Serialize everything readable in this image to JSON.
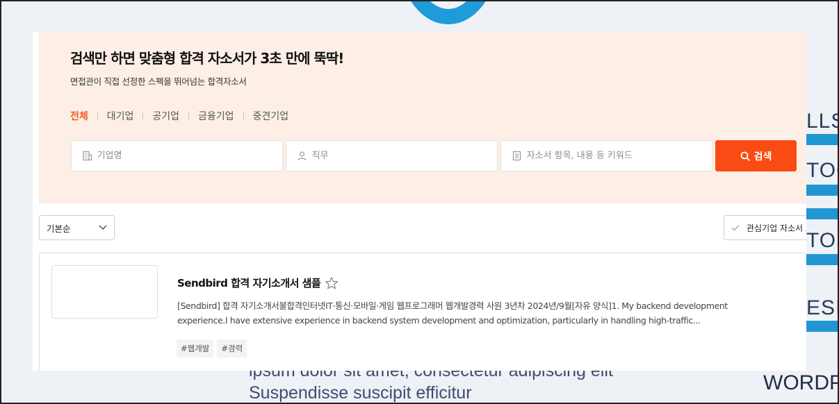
{
  "hero": {
    "title": "검색만 하면 맞춤형 합격 자소서가 3초 만에 뚝딱!",
    "subtitle": "면접관이 직접 선정한 스펙을 뛰어넘는 합격자소서"
  },
  "tabs": [
    {
      "label": "전체",
      "active": true
    },
    {
      "label": "대기업",
      "active": false
    },
    {
      "label": "공기업",
      "active": false
    },
    {
      "label": "금융기업",
      "active": false
    },
    {
      "label": "중견기업",
      "active": false
    }
  ],
  "search": {
    "company_placeholder": "기업명",
    "company_value": "",
    "job_placeholder": "직무",
    "job_value": "",
    "keyword_placeholder": "자소서 항목, 내용 등 키워드",
    "keyword_value": "",
    "button_label": "검색"
  },
  "sort": {
    "selected": "기본순"
  },
  "filter": {
    "label": "관심기업 자소서 보"
  },
  "result": {
    "title": "Sendbird 합격 자기소개서 샘플",
    "desc_line1": "[Sendbird] 합격 자기소개서불합격인터넷IT·통신·모바일·게임 웹프로그래머 웹개발경력 사원 3년차 2024년/9월[자유 양식]1. My backend development",
    "desc_line2": "experience.I have extensive experience in backend system development and optimization, particularly in handling high-traffic...",
    "tags": [
      "#웹개발",
      "#경력"
    ]
  },
  "background": {
    "words": [
      "LLS",
      "TOO",
      "TOS",
      "ESIG",
      "WORDP"
    ],
    "text_line1": "ipsum dolor sit amet, consectetur adipiscing elit",
    "text_line2": "Suspendisse suscipit efficitur"
  },
  "colors": {
    "accent": "#fa4b14",
    "active_tab": "#f15a24",
    "hero_bg": "#fdefe6"
  },
  "icons": {
    "company": "building-icon",
    "job": "person-icon",
    "keyword": "document-icon",
    "search": "search-icon",
    "sort": "chevron-down-icon",
    "filter": "check-icon",
    "favorite": "star-icon"
  }
}
